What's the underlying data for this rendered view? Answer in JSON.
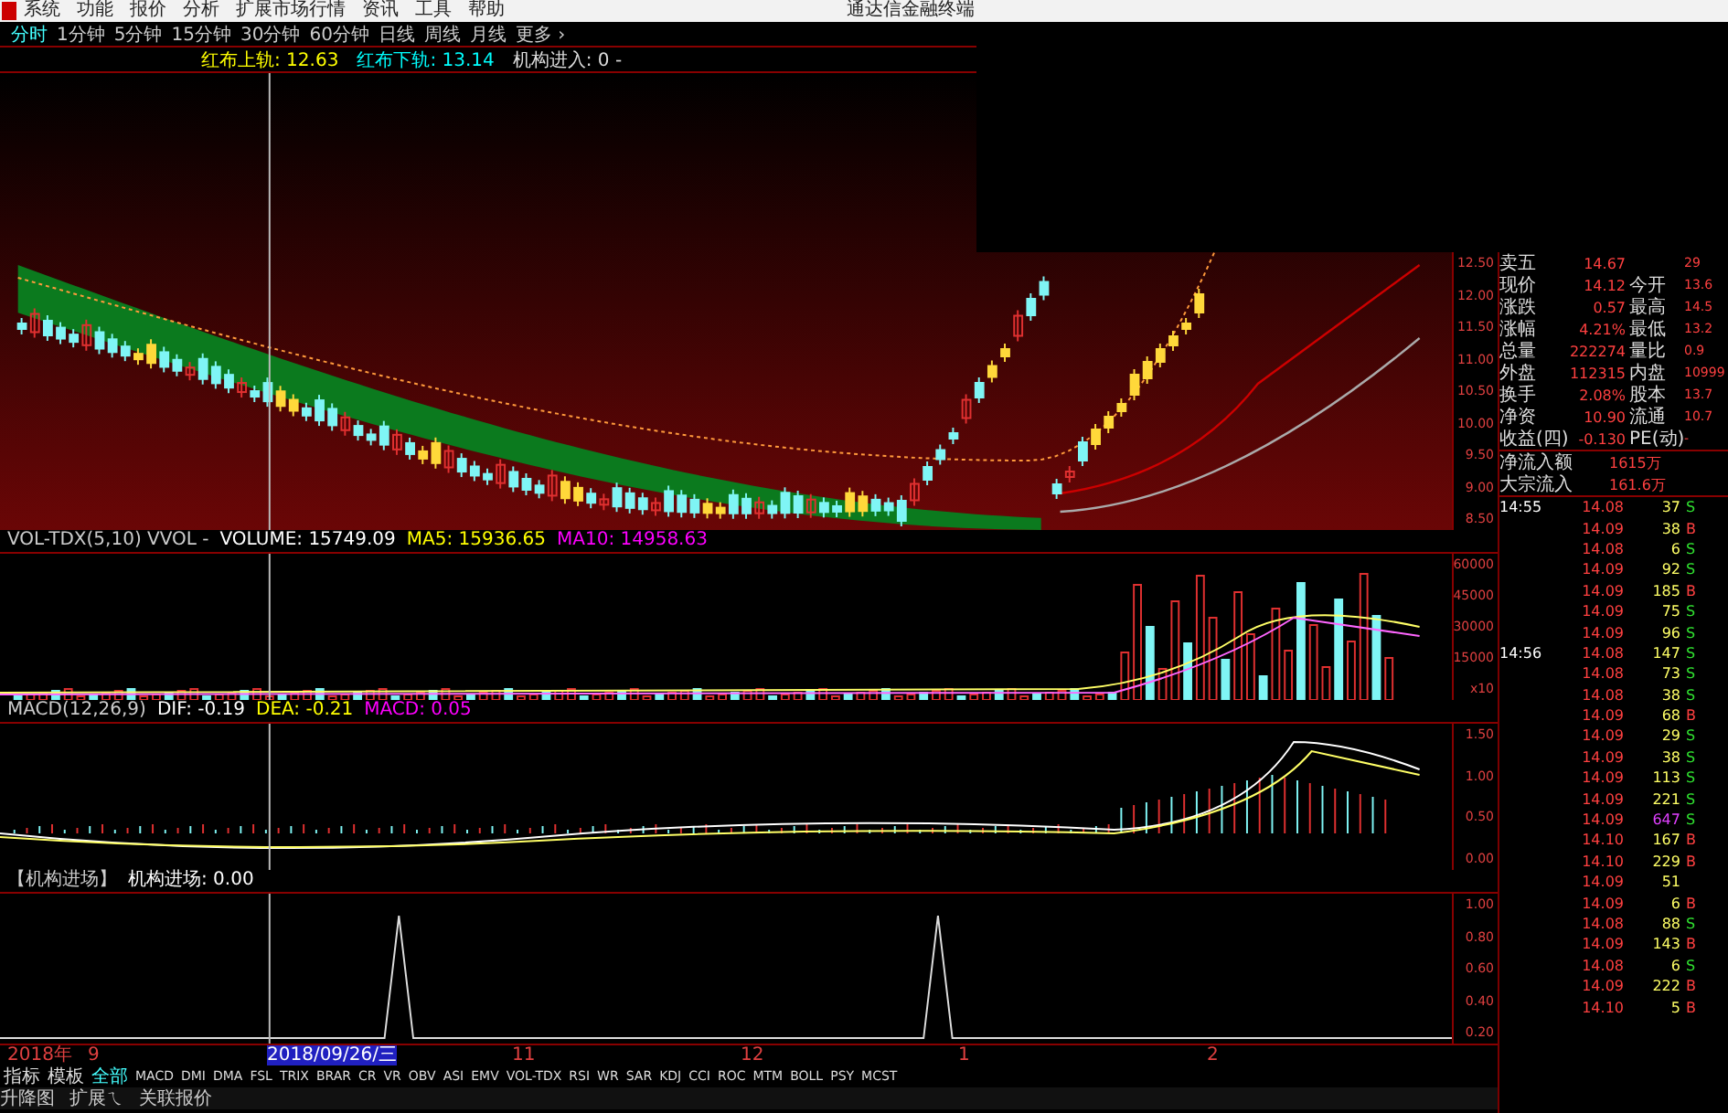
{
  "menu": {
    "items": [
      "系统",
      "功能",
      "报价",
      "分析",
      "扩展市场行情",
      "资讯",
      "工具",
      "帮助"
    ],
    "app_title": "通达信金融终端"
  },
  "periods": [
    {
      "label": "分时",
      "selected": true
    },
    {
      "label": "1分钟",
      "selected": false
    },
    {
      "label": "5分钟",
      "selected": false
    },
    {
      "label": "15分钟",
      "selected": false
    },
    {
      "label": "30分钟",
      "selected": false
    },
    {
      "label": "60分钟",
      "selected": false
    },
    {
      "label": "日线",
      "selected": false
    },
    {
      "label": "周线",
      "selected": false
    },
    {
      "label": "月线",
      "selected": false
    },
    {
      "label": "更多 ›",
      "selected": false
    }
  ],
  "indicator_line": [
    {
      "text": "红布上轨: 12.63",
      "color": "#ffff00"
    },
    {
      "text": "红布下轨: 13.14",
      "color": "#00ffff"
    },
    {
      "text": "机构进入: 0 -",
      "color": "#dddddd"
    }
  ],
  "main_chart": {
    "yticks": [
      "12.50",
      "12.00",
      "11.50",
      "11.00",
      "10.50",
      "10.00",
      "9.50",
      "9.00",
      "8.50"
    ]
  },
  "volume_panel": {
    "legend": [
      {
        "text": "VOL-TDX(5,10) VVOL -",
        "kind": "title"
      },
      {
        "text": "VOLUME: 15749.09",
        "kind": "main"
      },
      {
        "text": "MA5: 15936.65",
        "kind": "fast"
      },
      {
        "text": "MA10: 14958.63",
        "kind": "slow"
      }
    ],
    "yticks": [
      "60000",
      "45000",
      "30000",
      "15000",
      "x10"
    ]
  },
  "macd_panel": {
    "legend": [
      {
        "text": "MACD(12,26,9)",
        "kind": "title"
      },
      {
        "text": "DIF: -0.19",
        "kind": "main"
      },
      {
        "text": "DEA: -0.21",
        "kind": "fast"
      },
      {
        "text": "MACD: 0.05",
        "kind": "slow"
      }
    ],
    "yticks": [
      "1.50",
      "1.00",
      "0.50",
      "0.00"
    ]
  },
  "signal_panel": {
    "legend": [
      {
        "text": "【机构进场】",
        "kind": "title"
      },
      {
        "text": "机构进场: 0.00",
        "kind": "main"
      }
    ],
    "yticks": [
      "1.00",
      "0.80",
      "0.60",
      "0.40",
      "0.20"
    ]
  },
  "date_axis": [
    {
      "label": "2018年",
      "selected": false
    },
    {
      "label": "9",
      "selected": false
    },
    {
      "label": "2018/09/26/三",
      "selected": true
    },
    {
      "label": "11",
      "selected": false
    },
    {
      "label": "12",
      "selected": false
    },
    {
      "label": "1",
      "selected": false
    },
    {
      "label": "2",
      "selected": false
    }
  ],
  "indicator_tabs": [
    {
      "label": "指标",
      "selected": false
    },
    {
      "label": "模板",
      "selected": false
    },
    {
      "label": "全部",
      "selected": true
    },
    {
      "label": "MACD",
      "selected": false
    },
    {
      "label": "DMI",
      "selected": false
    },
    {
      "label": "DMA",
      "selected": false
    },
    {
      "label": "FSL",
      "selected": false
    },
    {
      "label": "TRIX",
      "selected": false
    },
    {
      "label": "BRAR",
      "selected": false
    },
    {
      "label": "CR",
      "selected": false
    },
    {
      "label": "VR",
      "selected": false
    },
    {
      "label": "OBV",
      "selected": false
    },
    {
      "label": "ASI",
      "selected": false
    },
    {
      "label": "EMV",
      "selected": false
    },
    {
      "label": "VOL-TDX",
      "selected": false
    },
    {
      "label": "RSI",
      "selected": false
    },
    {
      "label": "WR",
      "selected": false
    },
    {
      "label": "SAR",
      "selected": false
    },
    {
      "label": "KDJ",
      "selected": false
    },
    {
      "label": "CCI",
      "selected": false
    },
    {
      "label": "ROC",
      "selected": false
    },
    {
      "label": "MTM",
      "selected": false
    },
    {
      "label": "BOLL",
      "selected": false
    },
    {
      "label": "PSY",
      "selected": false
    },
    {
      "label": "MCST",
      "selected": false
    }
  ],
  "status_bar": [
    "升降图",
    "扩展ㄟ",
    "关联报价"
  ],
  "quote": [
    {
      "label": "卖五",
      "value": "14.67",
      "value2": "29"
    },
    {
      "label": "现价",
      "value": "14.12",
      "label2": "今开",
      "value2": "13.6"
    },
    {
      "label": "涨跌",
      "value": "0.57",
      "label2": "最高",
      "value2": "14.5"
    },
    {
      "label": "涨幅",
      "value": "4.21%",
      "label2": "最低",
      "value2": "13.2"
    },
    {
      "label": "总量",
      "value": "222274",
      "label2": "量比",
      "value2": "0.9"
    },
    {
      "label": "外盘",
      "value": "112315",
      "label2": "内盘",
      "value2": "10999"
    },
    {
      "label": "换手",
      "value": "2.08%",
      "label2": "股本",
      "value2": "13.7"
    },
    {
      "label": "净资",
      "value": "10.90",
      "label2": "流通",
      "value2": "10.7"
    },
    {
      "label": "收益(四)",
      "value": "-0.130",
      "label2": "PE(动)",
      "value2": "-"
    }
  ],
  "flows": [
    {
      "label": "净流入额",
      "value": "1615万"
    },
    {
      "label": "大宗流入",
      "value": "161.6万"
    }
  ],
  "ticks": [
    {
      "time": "14:55",
      "price": "14.08",
      "volume": "37",
      "side": "S",
      "large": false
    },
    {
      "price": "14.09",
      "volume": "38",
      "side": "B",
      "large": false
    },
    {
      "price": "14.08",
      "volume": "6",
      "side": "S",
      "large": false
    },
    {
      "price": "14.09",
      "volume": "92",
      "side": "S",
      "large": false
    },
    {
      "price": "14.09",
      "volume": "185",
      "side": "B",
      "large": false
    },
    {
      "price": "14.09",
      "volume": "75",
      "side": "S",
      "large": false
    },
    {
      "price": "14.09",
      "volume": "96",
      "side": "S",
      "large": false
    },
    {
      "time": "14:56",
      "price": "14.08",
      "volume": "147",
      "side": "S",
      "large": false
    },
    {
      "price": "14.08",
      "volume": "73",
      "side": "S",
      "large": false
    },
    {
      "price": "14.08",
      "volume": "38",
      "side": "S",
      "large": false
    },
    {
      "price": "14.09",
      "volume": "68",
      "side": "B",
      "large": false
    },
    {
      "price": "14.09",
      "volume": "29",
      "side": "S",
      "large": false
    },
    {
      "price": "14.09",
      "volume": "38",
      "side": "S",
      "large": false
    },
    {
      "price": "14.09",
      "volume": "113",
      "side": "S",
      "large": false
    },
    {
      "price": "14.09",
      "volume": "221",
      "side": "S",
      "large": false
    },
    {
      "price": "14.09",
      "volume": "647",
      "side": "S",
      "large": true
    },
    {
      "price": "14.10",
      "volume": "167",
      "side": "B",
      "large": false
    },
    {
      "price": "14.10",
      "volume": "229",
      "side": "B",
      "large": false
    },
    {
      "price": "14.09",
      "volume": "51",
      "large": false
    },
    {
      "price": "14.09",
      "volume": "6",
      "side": "B",
      "large": false
    },
    {
      "price": "14.08",
      "volume": "88",
      "side": "S",
      "large": false
    },
    {
      "price": "14.09",
      "volume": "143",
      "side": "B",
      "large": false
    },
    {
      "price": "14.08",
      "volume": "6",
      "side": "S",
      "large": false
    },
    {
      "price": "14.09",
      "volume": "222",
      "side": "B",
      "large": false
    },
    {
      "price": "14.10",
      "volume": "5",
      "side": "B",
      "large": false
    }
  ]
}
